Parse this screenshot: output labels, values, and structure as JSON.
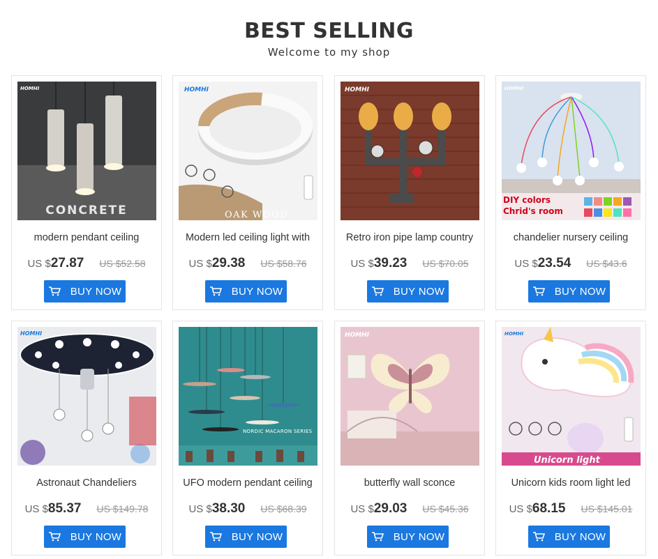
{
  "header": {
    "title": "BEST SELLING",
    "subtitle": "Welcome to my shop"
  },
  "button_label": "BUY NOW",
  "currency": "US $",
  "products": [
    {
      "title": "modern pendant ceiling",
      "price": "27.87",
      "old_price": "US $52.58",
      "brand": "HOMHI",
      "caption": "CONCRETE"
    },
    {
      "title": "Modern led ceiling light with",
      "price": "29.38",
      "old_price": "US $58.76",
      "brand": "HOMHI",
      "caption": "OAK WOOD"
    },
    {
      "title": "Retro iron pipe lamp country",
      "price": "39.23",
      "old_price": "US $70.05",
      "brand": "HOMHI",
      "caption": ""
    },
    {
      "title": "chandelier nursery ceiling",
      "price": "23.54",
      "old_price": "US $43.6",
      "brand": "HOMHI",
      "caption": "DIY colors Chrid's room"
    },
    {
      "title": "Astronaut Chandeliers",
      "price": "85.37",
      "old_price": "US $149.78",
      "brand": "HOMHI",
      "caption": ""
    },
    {
      "title": "UFO modern pendant ceiling",
      "price": "38.30",
      "old_price": "US $68.39",
      "brand": "",
      "caption": "NORDIC MACARON SERIES"
    },
    {
      "title": "butterfly wall sconce",
      "price": "29.03",
      "old_price": "US $45.36",
      "brand": "HOMHI",
      "caption": ""
    },
    {
      "title": "Unicorn kids room light led",
      "price": "68.15",
      "old_price": "US $145.01",
      "brand": "HOMHI",
      "caption": "Unicorn light"
    }
  ],
  "colors": {
    "button": "#1a78e0",
    "price_text": "#333333",
    "old_price_text": "#999999",
    "card_border": "#e4e4e4"
  }
}
